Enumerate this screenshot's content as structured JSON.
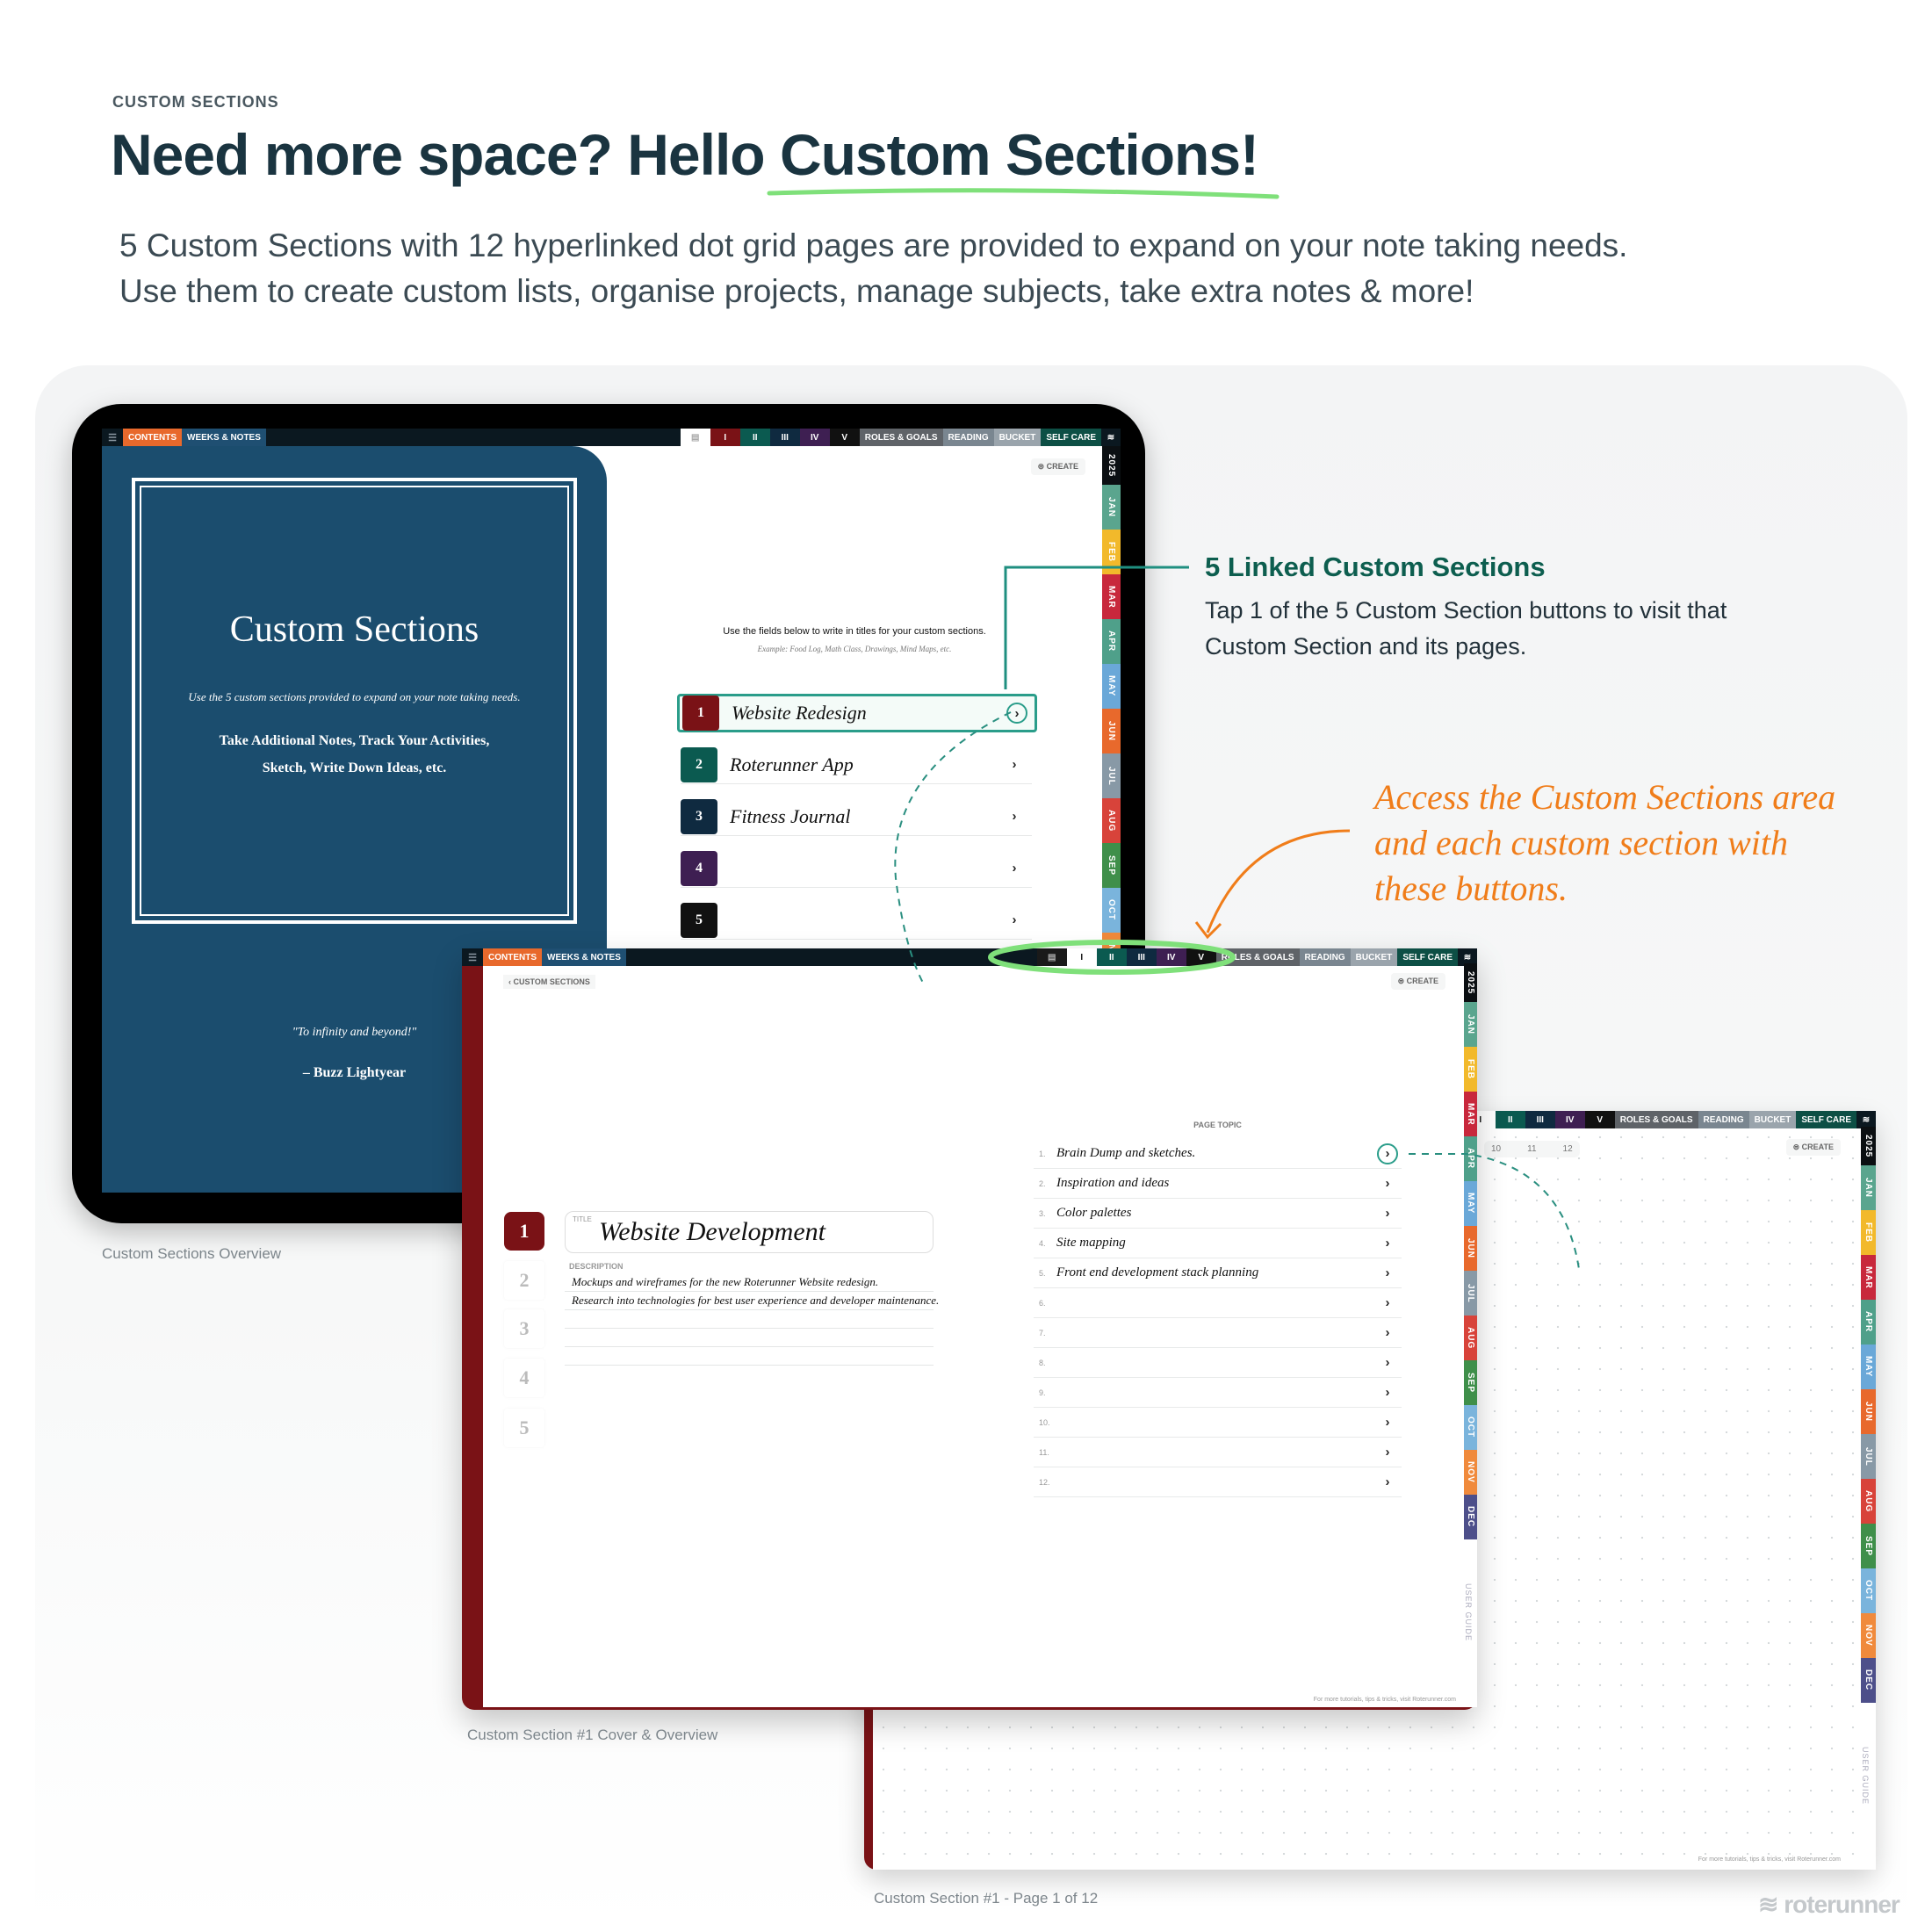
{
  "header": {
    "eyebrow": "CUSTOM SECTIONS",
    "title_part1": "Need more space? Hello ",
    "title_part2": "Custom Sections!",
    "subtitle_line1": "5 Custom Sections with 12 hyperlinked dot grid pages are provided to expand on your note taking needs.",
    "subtitle_line2": "Use them to create custom lists, organise projects, manage subjects, take extra notes & more!",
    "underline_color": "#7fe07a"
  },
  "topbar": {
    "menu_icon": "menu-icon",
    "left": [
      {
        "label": "CONTENTS",
        "color": "#e8692c"
      },
      {
        "label": "WEEKS & NOTES",
        "color": "#1f4f72"
      }
    ],
    "overview_icon": "list-icon",
    "right": [
      {
        "label": "I",
        "color": "#7a1216"
      },
      {
        "label": "II",
        "color": "#0b5a50"
      },
      {
        "label": "III",
        "color": "#0f2a40"
      },
      {
        "label": "IV",
        "color": "#3e1f52"
      },
      {
        "label": "V",
        "color": "#111111"
      },
      {
        "label": "ROLES & GOALS",
        "color": "#5f6368"
      },
      {
        "label": "READING",
        "color": "#7a8690"
      },
      {
        "label": "BUCKET",
        "color": "#9aa4ac"
      },
      {
        "label": "SELF CARE",
        "color": "#0d4f45"
      }
    ]
  },
  "months": [
    {
      "label": "2025",
      "color": "#0b0f12"
    },
    {
      "label": "JAN",
      "color": "#5aa58e"
    },
    {
      "label": "FEB",
      "color": "#f2b92b"
    },
    {
      "label": "MAR",
      "color": "#c8283c"
    },
    {
      "label": "APR",
      "color": "#4fa08a"
    },
    {
      "label": "MAY",
      "color": "#6aa8d8"
    },
    {
      "label": "JUN",
      "color": "#e8692c"
    },
    {
      "label": "JUL",
      "color": "#8899a6"
    },
    {
      "label": "AUG",
      "color": "#d8433a"
    },
    {
      "label": "SEP",
      "color": "#3f8f4a"
    },
    {
      "label": "OCT",
      "color": "#7ab4dc"
    },
    {
      "label": "NOV",
      "color": "#f08a3c"
    },
    {
      "label": "DEC",
      "color": "#4d4f8a"
    }
  ],
  "user_guide": "USER GUIDE",
  "create_label": "CREATE",
  "footer_note": "For more tutorials, tips & tricks, visit Roterunner.com",
  "overview": {
    "active_tab": "overview",
    "cover_title": "Custom Sections",
    "cover_intro": "Use the 5 custom sections provided to expand on your note taking needs.",
    "cover_body_line1": "Take Additional Notes, Track Your Activities,",
    "cover_body_line2": "Sketch, Write Down Ideas, etc.",
    "quote": "\"To infinity and beyond!\"",
    "quote_author": "– Buzz Lightyear",
    "instructions": "Use the fields below to write in titles for your custom sections.",
    "example": "Example: Food Log, Math Class, Drawings, Mind Maps, etc.",
    "sections": [
      {
        "num": "1",
        "title": "Website Redesign",
        "color": "#7a1216"
      },
      {
        "num": "2",
        "title": "Roterunner App",
        "color": "#0b5a50"
      },
      {
        "num": "3",
        "title": "Fitness Journal",
        "color": "#0f2a40"
      },
      {
        "num": "4",
        "title": "",
        "color": "#3e1f52"
      },
      {
        "num": "5",
        "title": "",
        "color": "#111111"
      }
    ],
    "caption": "Custom Sections Overview"
  },
  "annotation_linked": {
    "title": "5 Linked Custom Sections",
    "body_line1": "Tap 1 of the 5 Custom Section buttons to visit that",
    "body_line2": "Custom Section and its pages.",
    "color": "#0d5e4f"
  },
  "annotation_access": {
    "line1": "Access the Custom Sections area",
    "line2": "and each custom section with",
    "line3": "these buttons.",
    "color": "#f07d1a"
  },
  "section_cover": {
    "active_tab": "I",
    "back_link": "CUSTOM SECTIONS",
    "section_numbers": [
      "1",
      "2",
      "3",
      "4",
      "5"
    ],
    "title_label": "TITLE",
    "title_value": "Website Development",
    "description_label": "DESCRIPTION",
    "description_lines": [
      "Mockups and wireframes for the new Roterunner Website redesign.",
      "Research into technologies for best user experience and developer maintenance.",
      "",
      "",
      ""
    ],
    "page_topic_header": "PAGE TOPIC",
    "page_topics": [
      {
        "num": "1.",
        "text": "Brain Dump and sketches."
      },
      {
        "num": "2.",
        "text": "Inspiration and ideas"
      },
      {
        "num": "3.",
        "text": "Color palettes"
      },
      {
        "num": "4.",
        "text": "Site mapping"
      },
      {
        "num": "5.",
        "text": "Front end development stack planning"
      },
      {
        "num": "6.",
        "text": ""
      },
      {
        "num": "7.",
        "text": ""
      },
      {
        "num": "8.",
        "text": ""
      },
      {
        "num": "9.",
        "text": ""
      },
      {
        "num": "10.",
        "text": ""
      },
      {
        "num": "11.",
        "text": ""
      },
      {
        "num": "12.",
        "text": ""
      }
    ],
    "caption": "Custom Section #1 Cover & Overview"
  },
  "section_page": {
    "active_tab": "I",
    "pager": [
      "10",
      "11",
      "12"
    ],
    "caption": "Custom Section #1 - Page 1 of 12"
  },
  "brand": "roterunner"
}
